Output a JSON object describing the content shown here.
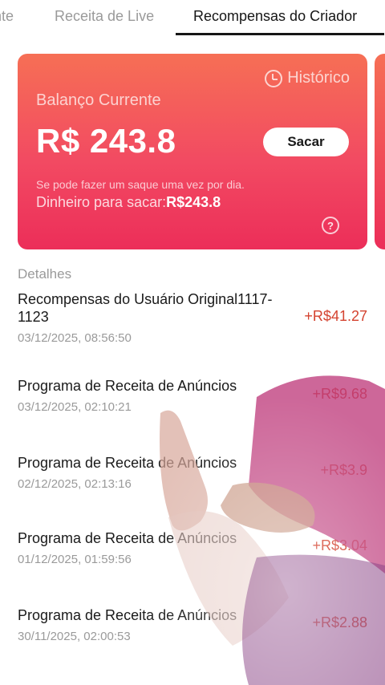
{
  "tabs": [
    "nte",
    "Receita de Live",
    "Recompensas do Criador"
  ],
  "card": {
    "history_label": "Histórico",
    "balance_label": "Balanço Currente",
    "balance_value": "R$ 243.8",
    "withdraw_label": "Sacar",
    "note": "Se pode fazer um saque uma vez por dia.",
    "available_label": "Dinheiro para sacar:",
    "available_value": "R$243.8",
    "help_symbol": "?"
  },
  "details": {
    "heading": "Detalhes",
    "rows": [
      {
        "title": "Recompensas do Usuário Original1117-1123",
        "date": "03/12/2025, 08:56:50",
        "amount": "+R$41.27"
      },
      {
        "title": "Programa de Receita de Anúncios",
        "date": "03/12/2025, 02:10:21",
        "amount": "+R$9.68"
      },
      {
        "title": "Programa de Receita de Anúncios",
        "date": "02/12/2025, 02:13:16",
        "amount": "+R$3.9"
      },
      {
        "title": "Programa de Receita de Anúncios",
        "date": "01/12/2025, 01:59:56",
        "amount": "+R$3.04"
      },
      {
        "title": "Programa de Receita de Anúncios",
        "date": "30/11/2025, 02:00:53",
        "amount": "+R$2.88"
      }
    ]
  },
  "colors": {
    "card_top": "#f66f55",
    "card_bottom": "#ec2e59",
    "amount": "#d44330",
    "overlay_shirt": "#c0407e"
  }
}
